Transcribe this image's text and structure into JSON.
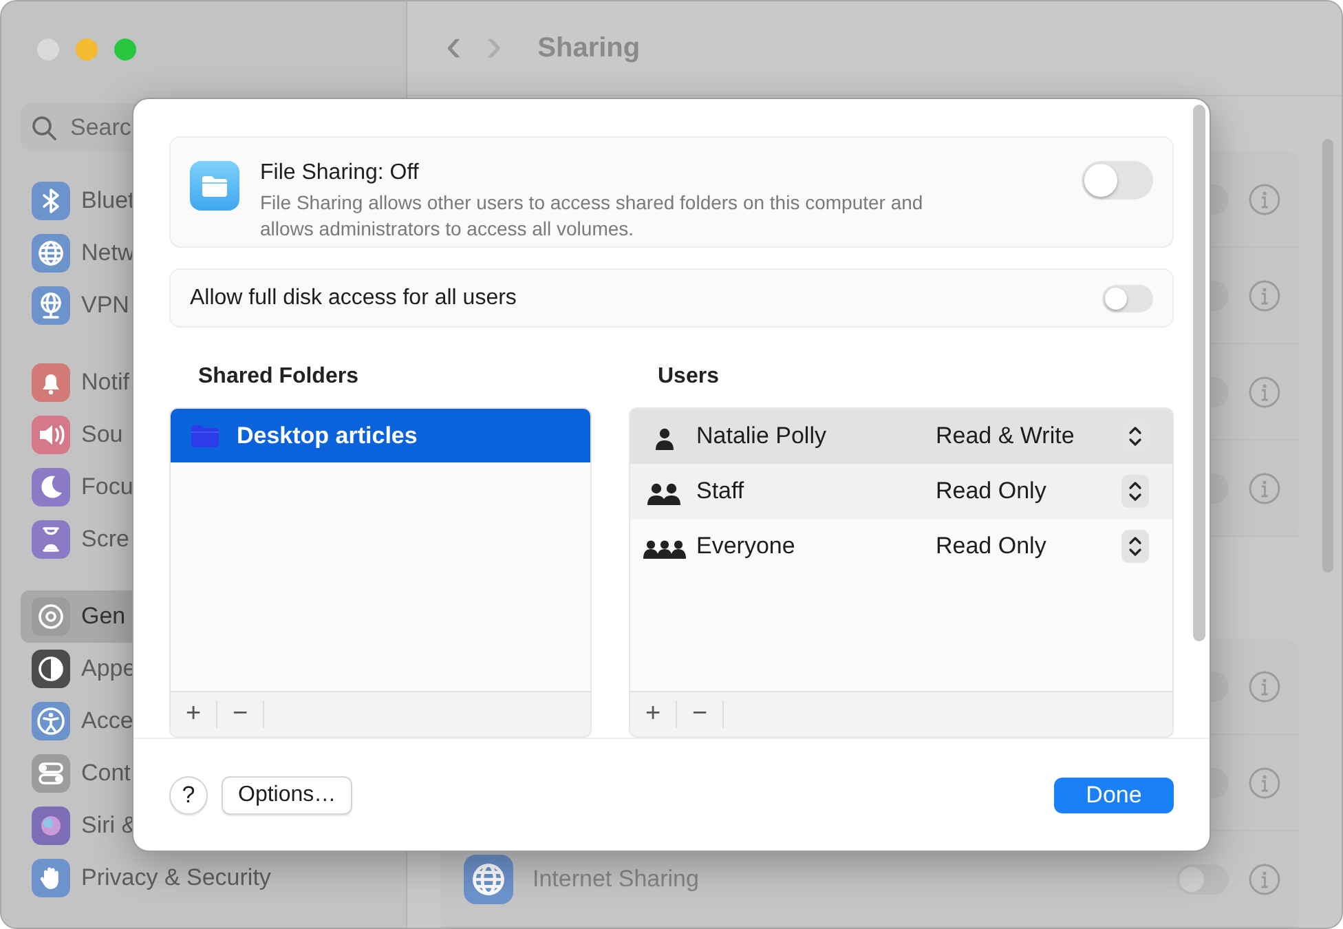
{
  "window": {
    "title": "Sharing",
    "back": "‹",
    "forward": "›"
  },
  "sidebar": {
    "search": {
      "placeholder": "Searc"
    },
    "groups": [
      {
        "items": [
          {
            "label": "Bluet",
            "color": "#6c93cc",
            "selected": false
          },
          {
            "label": "Netw",
            "color": "#6c93cc",
            "selected": false
          },
          {
            "label": "VPN",
            "color": "#6c93cc",
            "selected": false
          }
        ]
      },
      {
        "items": [
          {
            "label": "Notif",
            "color": "#d27b76",
            "selected": false
          },
          {
            "label": "Sou",
            "color": "#d4788a",
            "selected": false
          },
          {
            "label": "Focu",
            "color": "#8b7bc6",
            "selected": false
          },
          {
            "label": "Scre",
            "color": "#8b7bc6",
            "selected": false
          }
        ]
      },
      {
        "items": [
          {
            "label": "Gen",
            "color": "#9c9c9c",
            "selected": true
          },
          {
            "label": "Appe",
            "color": "#4c4c4c",
            "selected": false
          },
          {
            "label": "Acce",
            "color": "#6c93cc",
            "selected": false
          },
          {
            "label": "Cont",
            "color": "#9c9c9c",
            "selected": false
          },
          {
            "label": "Siri &",
            "color": "#7d6cb6",
            "selected": false
          },
          {
            "label": "Privacy & Security",
            "color": "#6c93cc",
            "selected": false
          }
        ]
      }
    ]
  },
  "main": {
    "groups": [
      {
        "rows": [
          {
            "on": false
          },
          {
            "on": false
          },
          {
            "on": false
          },
          {
            "on": false
          }
        ]
      },
      {
        "rows": [
          {
            "on": false
          },
          {
            "on": false
          },
          {
            "label": "Internet Sharing",
            "on": false
          }
        ]
      }
    ]
  },
  "sheet": {
    "service": {
      "title": "File Sharing: Off",
      "description": "File Sharing allows other users to access shared folders on this computer and allows administrators to access all volumes.",
      "on": false
    },
    "full_disk_access": {
      "label": "Allow full disk access for all users",
      "on": false
    },
    "shared_folders": {
      "heading": "Shared Folders",
      "items": [
        {
          "name": "Desktop articles",
          "selected": true
        }
      ],
      "add": "+",
      "remove": "−"
    },
    "users": {
      "heading": "Users",
      "items": [
        {
          "name": "Natalie Polly",
          "kind": "person",
          "permission": "Read & Write",
          "selected": true
        },
        {
          "name": "Staff",
          "kind": "group",
          "permission": "Read Only",
          "selected": false
        },
        {
          "name": "Everyone",
          "kind": "everyone",
          "permission": "Read Only",
          "selected": false
        }
      ],
      "add": "+",
      "remove": "−"
    },
    "buttons": {
      "help": "?",
      "options": "Options…",
      "done": "Done"
    }
  }
}
